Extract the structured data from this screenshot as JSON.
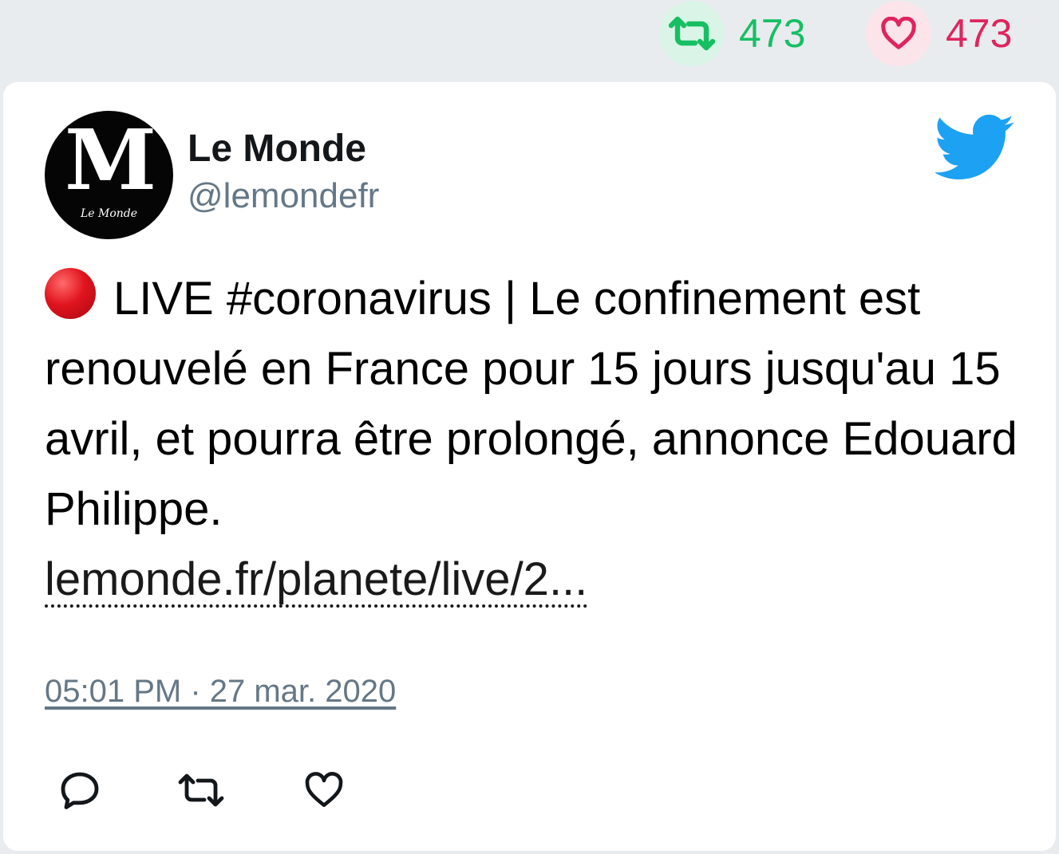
{
  "stats": {
    "retweets": "473",
    "likes": "473",
    "retweet_icon": "retweet-icon",
    "like_icon": "heart-icon",
    "retweet_color": "#17bf63",
    "like_color": "#e0245e"
  },
  "author": {
    "name": "Le Monde",
    "handle": "@lemondefr",
    "avatar_glyph": "M",
    "avatar_caption": "Le Monde"
  },
  "tweet": {
    "live_icon": "red-circle-icon",
    "text": "LIVE #coronavirus | Le confinement est renouvelé en France pour 15 jours jusqu'au 15 avril, et pourra être prolongé, annonce Edouard Philippe.",
    "link": "lemonde.fr/planete/live/2...",
    "timestamp": "05:01 PM · 27 mar. 2020"
  },
  "actions": {
    "reply_icon": "reply-icon",
    "retweet_icon": "retweet-icon",
    "like_icon": "heart-icon"
  },
  "brand": {
    "twitter_blue": "#1da1f2",
    "brand_icon": "twitter-bird-icon"
  }
}
